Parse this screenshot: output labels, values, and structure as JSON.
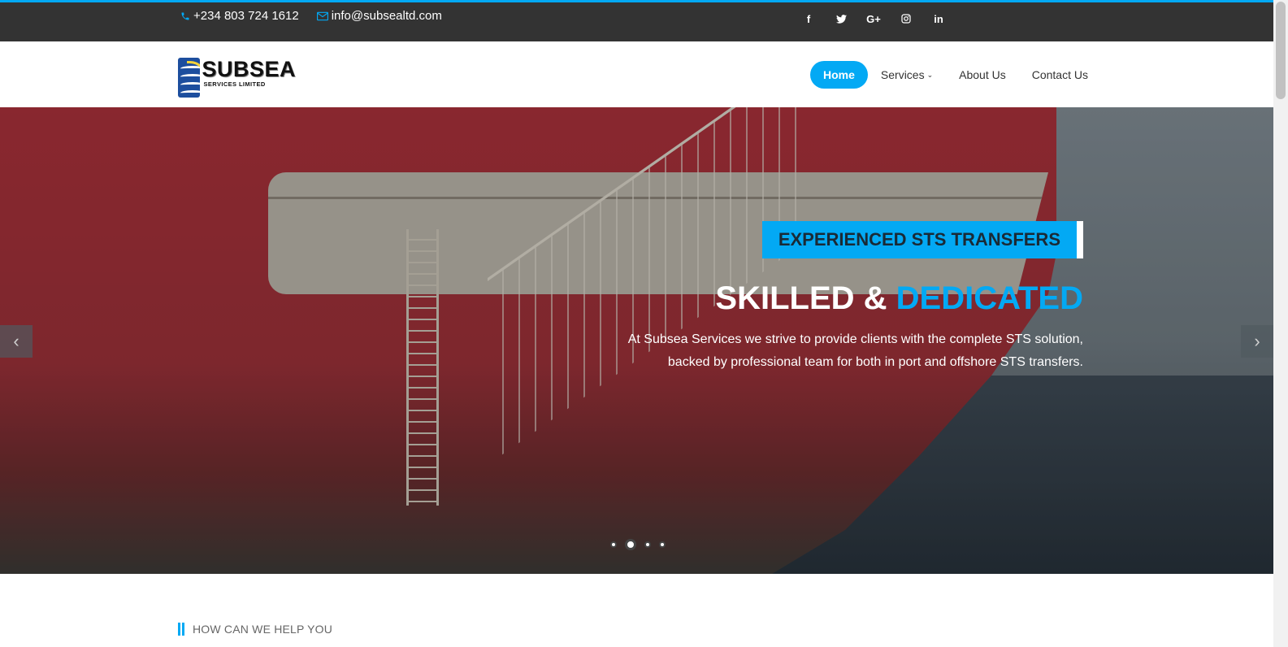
{
  "topbar": {
    "phone": "+234 803 724 1612",
    "email": "info@subsealtd.com",
    "phone_icon": "phone-icon",
    "email_icon": "envelope-icon",
    "social": [
      {
        "name": "facebook-icon",
        "glyph": "f"
      },
      {
        "name": "twitter-icon",
        "glyph": "t"
      },
      {
        "name": "google-plus-icon",
        "glyph": "G+"
      },
      {
        "name": "instagram-icon",
        "glyph": "◎"
      },
      {
        "name": "linkedin-icon",
        "glyph": "in"
      }
    ]
  },
  "logo": {
    "name": "SUBSEA",
    "tagline": "SERVICES LIMITED"
  },
  "nav": {
    "items": [
      {
        "label": "Home",
        "active": true
      },
      {
        "label": "Services",
        "dropdown": true
      },
      {
        "label": "About Us"
      },
      {
        "label": "Contact Us"
      }
    ]
  },
  "hero": {
    "tag": "EXPERIENCED STS TRANSFERS",
    "heading_part1": "SKILLED & ",
    "heading_part2": "DEDICATED",
    "description_line1": "At Subsea Services we strive to provide clients with the complete STS solution,",
    "description_line2": "backed by professional team for both in port and offshore STS transfers.",
    "prev_glyph": "‹",
    "next_glyph": "›",
    "slides_count": 4,
    "active_slide": 2
  },
  "section": {
    "title": "HOW CAN WE HELP YOU"
  },
  "colors": {
    "accent": "#03a9f4",
    "topbar_bg": "#333333",
    "text_dark": "#333333"
  }
}
